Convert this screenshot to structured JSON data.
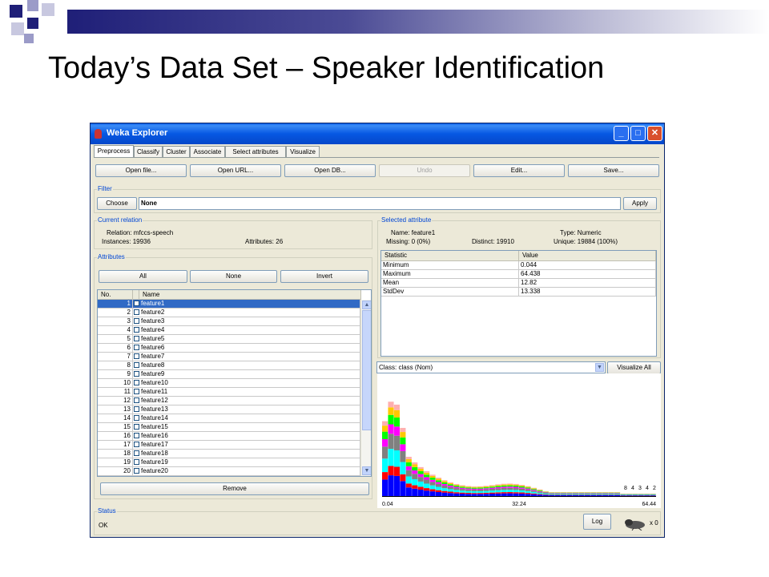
{
  "slide": {
    "title": "Today’s Data Set – Speaker Identification"
  },
  "window": {
    "title": "Weka Explorer",
    "minimize_glyph": "_",
    "maximize_glyph": "□",
    "close_glyph": "✕",
    "app_icon": "weka-bird-icon"
  },
  "tabs": [
    "Preprocess",
    "Classify",
    "Cluster",
    "Associate",
    "Select attributes",
    "Visualize"
  ],
  "toolbar": {
    "open_file": "Open file...",
    "open_url": "Open URL...",
    "open_db": "Open DB...",
    "undo": "Undo",
    "edit": "Edit...",
    "save": "Save..."
  },
  "filter": {
    "label": "Filter",
    "choose": "Choose",
    "value": "None",
    "apply": "Apply"
  },
  "current_relation": {
    "label": "Current relation",
    "relation": "Relation: mfccs-speech",
    "instances": "Instances: 19936",
    "attributes": "Attributes: 26"
  },
  "attributes_panel": {
    "label": "Attributes",
    "all": "All",
    "none": "None",
    "invert": "Invert",
    "col_no": "No.",
    "col_name": "Name",
    "rows": [
      {
        "no": "1",
        "name": "feature1"
      },
      {
        "no": "2",
        "name": "feature2"
      },
      {
        "no": "3",
        "name": "feature3"
      },
      {
        "no": "4",
        "name": "feature4"
      },
      {
        "no": "5",
        "name": "feature5"
      },
      {
        "no": "6",
        "name": "feature6"
      },
      {
        "no": "7",
        "name": "feature7"
      },
      {
        "no": "8",
        "name": "feature8"
      },
      {
        "no": "9",
        "name": "feature9"
      },
      {
        "no": "10",
        "name": "feature10"
      },
      {
        "no": "11",
        "name": "feature11"
      },
      {
        "no": "12",
        "name": "feature12"
      },
      {
        "no": "13",
        "name": "feature13"
      },
      {
        "no": "14",
        "name": "feature14"
      },
      {
        "no": "15",
        "name": "feature15"
      },
      {
        "no": "16",
        "name": "feature16"
      },
      {
        "no": "17",
        "name": "feature17"
      },
      {
        "no": "18",
        "name": "feature18"
      },
      {
        "no": "19",
        "name": "feature19"
      },
      {
        "no": "20",
        "name": "feature20"
      }
    ],
    "remove": "Remove"
  },
  "selected_attribute": {
    "label": "Selected attribute",
    "name": "Name: feature1",
    "type": "Type: Numeric",
    "missing": "Missing: 0 (0%)",
    "distinct": "Distinct: 19910",
    "unique": "Unique: 19884 (100%)",
    "stats_header": [
      "Statistic",
      "Value"
    ],
    "stats": [
      {
        "stat": "Minimum",
        "value": "0.044"
      },
      {
        "stat": "Maximum",
        "value": "64.438"
      },
      {
        "stat": "Mean",
        "value": "12.82"
      },
      {
        "stat": "StdDev",
        "value": "13.338"
      }
    ]
  },
  "class_selector": {
    "value": "Class: class (Nom)",
    "visualize_all": "Visualize All"
  },
  "histogram": {
    "x_min_label": "0.04",
    "x_mid_label": "32.24",
    "x_max_label": "64.44",
    "top_counts": [
      "8",
      "4",
      "3",
      "4",
      "2"
    ],
    "colors": [
      "#0000ff",
      "#ff0000",
      "#00ffff",
      "#808080",
      "#ff00ff",
      "#00ff00",
      "#ffc800",
      "#ffafaf",
      "#000080",
      "#008080"
    ]
  },
  "status": {
    "label": "Status",
    "text": "OK",
    "log": "Log",
    "count": "x 0"
  }
}
